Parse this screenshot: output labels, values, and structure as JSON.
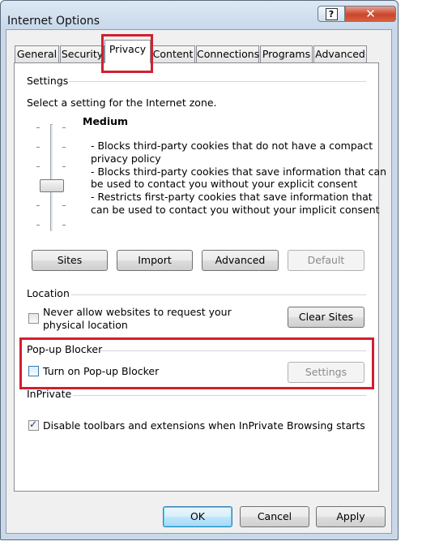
{
  "window": {
    "title": "Internet Options",
    "help_glyph": "?",
    "close_glyph": "✕"
  },
  "tabs": [
    {
      "label": "General"
    },
    {
      "label": "Security"
    },
    {
      "label": "Privacy",
      "active": true
    },
    {
      "label": "Content"
    },
    {
      "label": "Connections"
    },
    {
      "label": "Programs"
    },
    {
      "label": "Advanced"
    }
  ],
  "settings": {
    "group_label": "Settings",
    "instruction": "Select a setting for the Internet zone.",
    "level_name": "Medium",
    "slider_level": "Medium",
    "description_lines": [
      "- Blocks third-party cookies that do not have a compact",
      "privacy policy",
      "- Blocks third-party cookies that save information that can",
      "be used to contact you without your explicit consent",
      "- Restricts first-party cookies that save information that",
      "can be used to contact you without your implicit consent"
    ],
    "buttons": {
      "sites": "Sites",
      "import": "Import",
      "advanced": "Advanced",
      "default": "Default"
    }
  },
  "location": {
    "group_label": "Location",
    "checkbox_label_line1": "Never allow websites to request your",
    "checkbox_label_line2": "physical location",
    "checked": false,
    "clear_sites": "Clear Sites"
  },
  "popup_blocker": {
    "group_label": "Pop-up Blocker",
    "checkbox_label": "Turn on Pop-up Blocker",
    "checked": false,
    "settings_button": "Settings"
  },
  "inprivate": {
    "group_label": "InPrivate",
    "checkbox_label": "Disable toolbars and extensions when InPrivate Browsing starts",
    "checked": true,
    "check_glyph": "✓"
  },
  "footer": {
    "ok": "OK",
    "cancel": "Cancel",
    "apply": "Apply"
  },
  "colors": {
    "highlight": "#d1202f",
    "close_button": "#c9462c",
    "title_bar": "#c9d9ea"
  }
}
